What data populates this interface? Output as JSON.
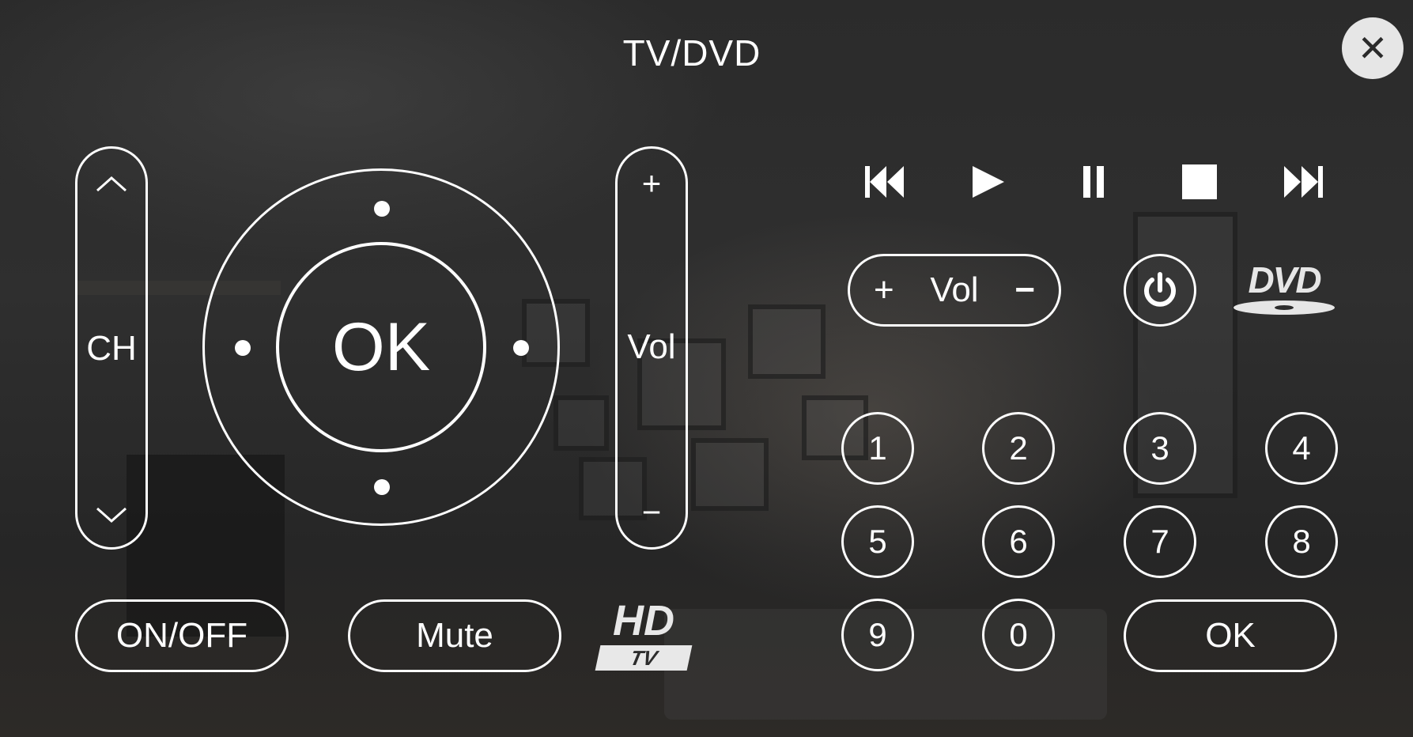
{
  "window": {
    "title": "TV/DVD"
  },
  "close": {
    "icon": "close-icon",
    "glyph": "✕"
  },
  "tv": {
    "channel": {
      "label": "CH",
      "up_glyph": "︿",
      "down_glyph": "﹀"
    },
    "dpad": {
      "ok_label": "OK"
    },
    "volume": {
      "label": "Vol",
      "plus": "+",
      "minus": "−"
    },
    "on_off_label": "ON/OFF",
    "mute_label": "Mute",
    "logo": {
      "main": "HD",
      "sub": "TV"
    }
  },
  "dvd": {
    "transport": [
      "previous-track-icon",
      "play-icon",
      "pause-icon",
      "stop-icon",
      "next-track-icon"
    ],
    "volume_pill": {
      "plus": "+",
      "label": "Vol",
      "minus": "−"
    },
    "power": {
      "icon": "power-icon"
    },
    "logo": {
      "text": "DVD"
    },
    "keypad": [
      "1",
      "2",
      "3",
      "4",
      "5",
      "6",
      "7",
      "8",
      "9",
      "0"
    ],
    "ok_label": "OK"
  },
  "colors": {
    "foreground": "#ffffff",
    "background": "#2c2c2c",
    "close_bg": "#e6e6e6"
  }
}
